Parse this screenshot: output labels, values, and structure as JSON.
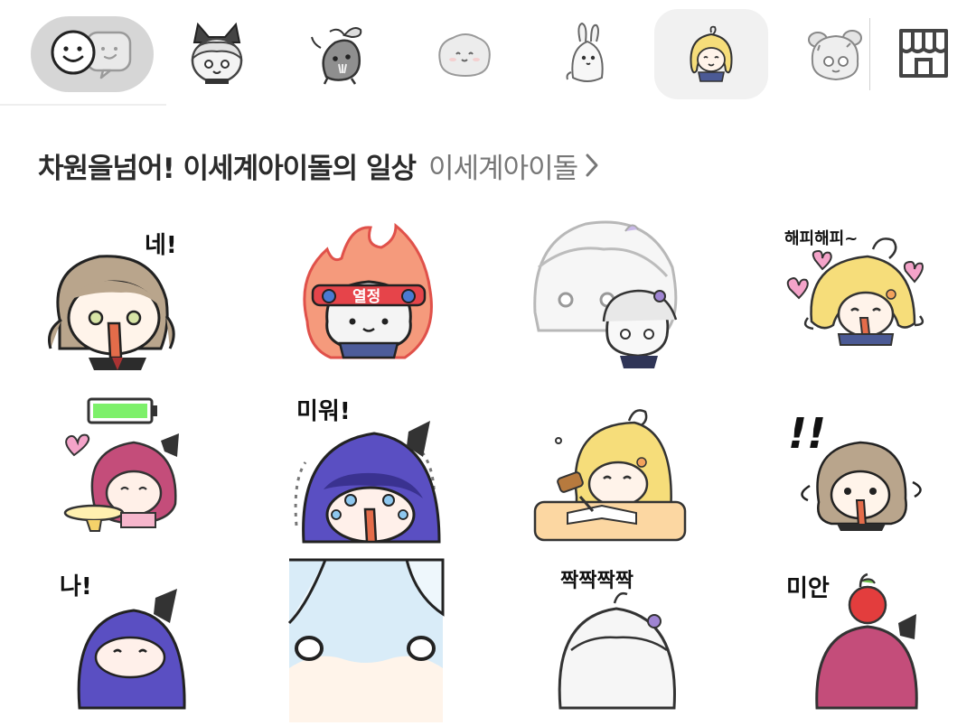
{
  "tabs": [
    {
      "name": "emoticon-home-tab",
      "state": "active"
    },
    {
      "name": "sticker-pack-witch-tab"
    },
    {
      "name": "sticker-pack-sprout-tab"
    },
    {
      "name": "sticker-pack-blob-tab"
    },
    {
      "name": "sticker-pack-bunny-tab"
    },
    {
      "name": "sticker-pack-idol-tab",
      "state": "selected"
    },
    {
      "name": "sticker-pack-sheep-girl-tab"
    }
  ],
  "pack": {
    "title": "차원을넘어! 이세계아이돌의 일상",
    "author": "이세계아이돌"
  },
  "stickers": [
    {
      "caption": "네!"
    },
    {
      "caption": "열정"
    },
    {
      "caption": ""
    },
    {
      "caption": "해피해피~"
    },
    {
      "caption": ""
    },
    {
      "caption": "미워!"
    },
    {
      "caption": ""
    },
    {
      "caption": "!!"
    },
    {
      "caption": "나!"
    },
    {
      "caption": ""
    },
    {
      "caption": "짝짝짝짝"
    },
    {
      "caption": "미안"
    }
  ],
  "colors": {
    "active_tab_bg": "#d6d6d6",
    "selected_tab_bg": "#f1f1f1",
    "title": "#2b2b2b",
    "author": "#777777"
  }
}
